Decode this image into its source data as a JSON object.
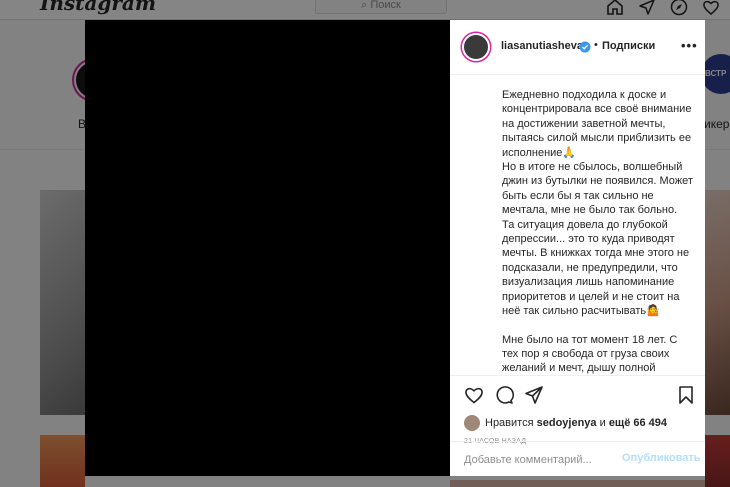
{
  "app": {
    "logo": "Instagram"
  },
  "topbar": {
    "search_placeholder": "Поиск"
  },
  "stories": {
    "left_label": "B",
    "right_label": "икер",
    "right_badge": "ВСТР"
  },
  "post": {
    "username": "liasanutiasheva",
    "separator": "•",
    "follow_label": "Подписки",
    "more_label": "•••",
    "caption_p1": "Ежедневно подходила к доске и концентрировала все своё внимание на достижении заветной мечты, пытаясь силой мысли приблизить ее исполнение🙏\nНо в итоге не сбылось, волшебный джин из бутылки не появился. Может быть если бы я так сильно не мечтала, мне не было так больно.\nТа ситуация довела до глубокой депрессии... это то куда приводят мечты. В книжках тогда мне этого не подсказали, не предупредили, что визуализация лишь напоминание приоритетов и целей и не стоит на неё так сильно расчитывать🤷",
    "caption_p2": "Мне было на тот момент 18 лет. С тех пор я свобода от груза своих желаний и мечт, дышу полной",
    "likes_prefix": "Нравится",
    "likes_user": "sedoyjenya",
    "likes_middle": "и",
    "likes_count": "ещё 66 494",
    "timestamp": "21 ЧАСОВ НАЗАД",
    "comment_placeholder": "Добавьте комментарий...",
    "publish_label": "Опубликовать"
  },
  "icons": [
    "search-icon",
    "home-icon",
    "direct-icon",
    "explore-icon",
    "heart-icon",
    "verified-icon",
    "like-icon",
    "comment-icon",
    "share-icon",
    "bookmark-icon"
  ],
  "colors": {
    "accent_ring": "#d6249f",
    "verified_blue": "#3897f0",
    "publish_disabled": "#b2dffc"
  }
}
